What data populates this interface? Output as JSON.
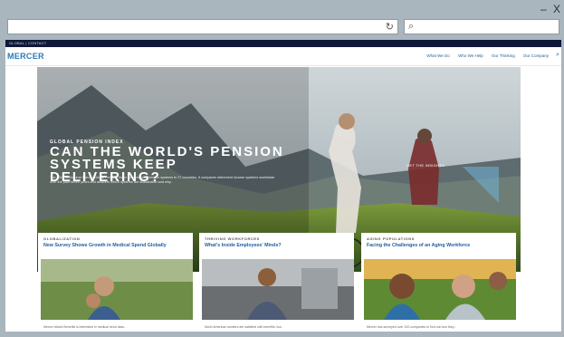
{
  "browser": {
    "window_controls": "– X",
    "address_value": "",
    "refresh_icon": "refresh-icon",
    "search_icon": "search-icon"
  },
  "site": {
    "top_strip": "GLOBAL | CONTACT",
    "logo": "MERCER",
    "nav": [
      "What We Do",
      "Who We Help",
      "Our Thinking",
      "Our Company"
    ],
    "nav_search_icon": "search-icon"
  },
  "hero": {
    "eyebrow": "GLOBAL PENSION INDEX",
    "headline": "CAN THE WORLD'S PENSION SYSTEMS KEEP DELIVERING?",
    "blurb": "The 2016 Melbourne Mercer Global Pension Index benchmarks pension systems in 27 countries. It compares retirement income systems worldwide over the past seven years and answers which systems are sustainable and why.",
    "cta": "GET THE INSIGHTS"
  },
  "cards": [
    {
      "category": "GLOBALIZATION",
      "title": "New Survey Shows Growth in Medical Spend Globally",
      "teaser": "Mercer Marsh Benefits is interested in medical trend data..."
    },
    {
      "category": "THRIVING WORKFORCES",
      "title": "What's Inside Employees' Minds?",
      "teaser": "North American workers are satisfied with benefits, but..."
    },
    {
      "category": "AGING POPULATIONS",
      "title": "Facing the Challenges of an Aging Workforce",
      "teaser": "Mercer has surveyed over 100 companies to find out how they..."
    }
  ],
  "colors": {
    "brand": "#2a7ab8",
    "link": "#1f5c9e",
    "top_strip": "#0f1838",
    "chrome": "#a9b6bd"
  }
}
